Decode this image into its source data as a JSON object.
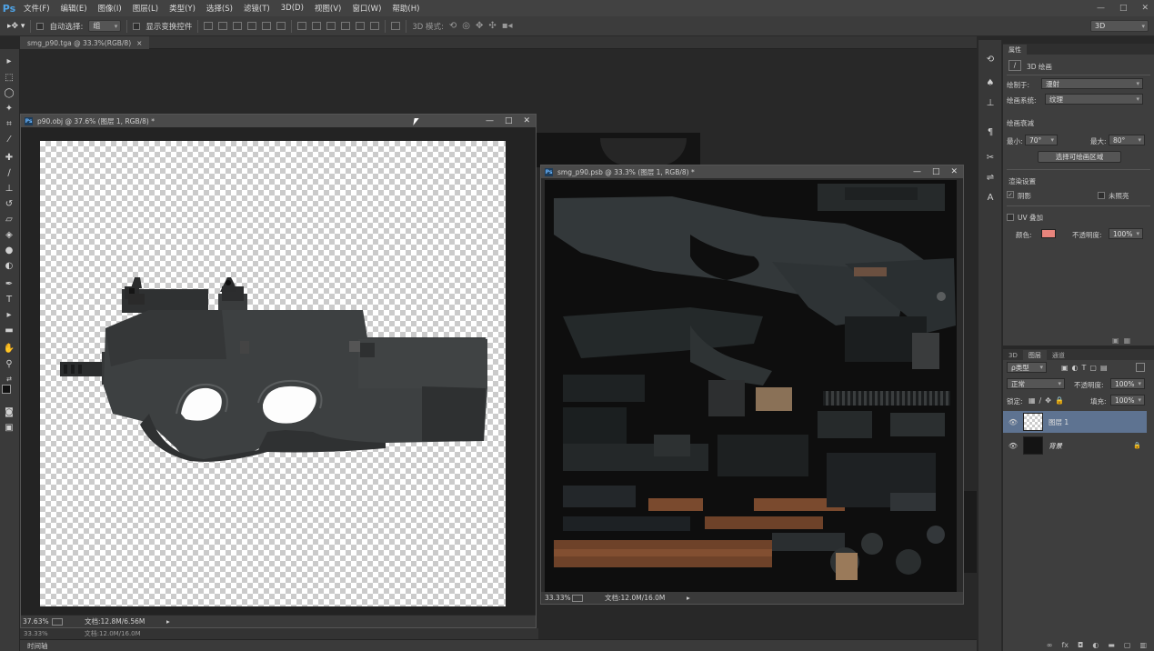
{
  "app": {
    "logo": "Ps"
  },
  "menu": [
    "文件(F)",
    "编辑(E)",
    "图像(I)",
    "图层(L)",
    "类型(Y)",
    "选择(S)",
    "滤镜(T)",
    "3D(D)",
    "视图(V)",
    "窗口(W)",
    "帮助(H)"
  ],
  "window_controls": {
    "minimize": "—",
    "maximize": "□",
    "close": "✕"
  },
  "options": {
    "auto_select_label": "自动选择:",
    "auto_select_value": "组",
    "show_transform_label": "显示变换控件",
    "mode_3d_label": "3D 模式:",
    "workspace": "3D"
  },
  "doc_tab": {
    "title": "smg_p90.tga @ 33.3%(RGB/8)",
    "close": "×"
  },
  "window1": {
    "title": "p90.obj @ 37.6% (图层 1, RGB/8) *",
    "zoom": "37.63%",
    "doc_info": "文档:12.8M/6.56M",
    "arrow": "▸"
  },
  "window2": {
    "title": "smg_p90.psb @ 33.3% (图层 1, RGB/8) *",
    "zoom": "33.33%",
    "doc_info": "文档:12.0M/16.0M",
    "arrow": "▸"
  },
  "behind_status": {
    "zoom": "33.33%",
    "doc_info": "文档:12.0M/16.0M"
  },
  "timeline_label": "时间轴",
  "properties": {
    "tab": "属性",
    "header": "3D 绘画",
    "paint_on_label": "绘制于:",
    "paint_on_value": "漫射",
    "paint_system_label": "绘画系统:",
    "paint_system_value": "纹理",
    "paint_falloff_label": "绘画衰减",
    "min_label": "最小:",
    "min_value": "70°",
    "max_label": "最大:",
    "max_value": "80°",
    "select_paintable_button": "选择可绘画区域",
    "render_settings_label": "渲染设置",
    "shadow_label": "阴影",
    "unlit_label": "未照亮",
    "uv_overlay_label": "UV 叠加",
    "color_label": "颜色:",
    "opacity_label": "不透明度:",
    "opacity_value": "100%",
    "swatch_color": "#e8847c"
  },
  "layers": {
    "tabs": [
      "3D",
      "图层",
      "通道"
    ],
    "filter_value": "ρ类型",
    "blend_mode": "正常",
    "opacity_label": "不透明度:",
    "opacity_value": "100%",
    "lock_label": "锁定:",
    "fill_label": "填充:",
    "fill_value": "100%",
    "items": [
      {
        "name": "图层 1",
        "selected": true
      },
      {
        "name": "背景",
        "selected": false
      }
    ],
    "footer_icons": [
      "link-icon",
      "fx-icon",
      "mask-icon",
      "adjustment-icon",
      "folder-icon",
      "new-layer-icon",
      "trash-icon"
    ]
  },
  "colors": {
    "accent": "#4fa3e6",
    "selected_layer": "#5e7391",
    "wood": "#8a5535",
    "gun_body": "#3d4041"
  }
}
